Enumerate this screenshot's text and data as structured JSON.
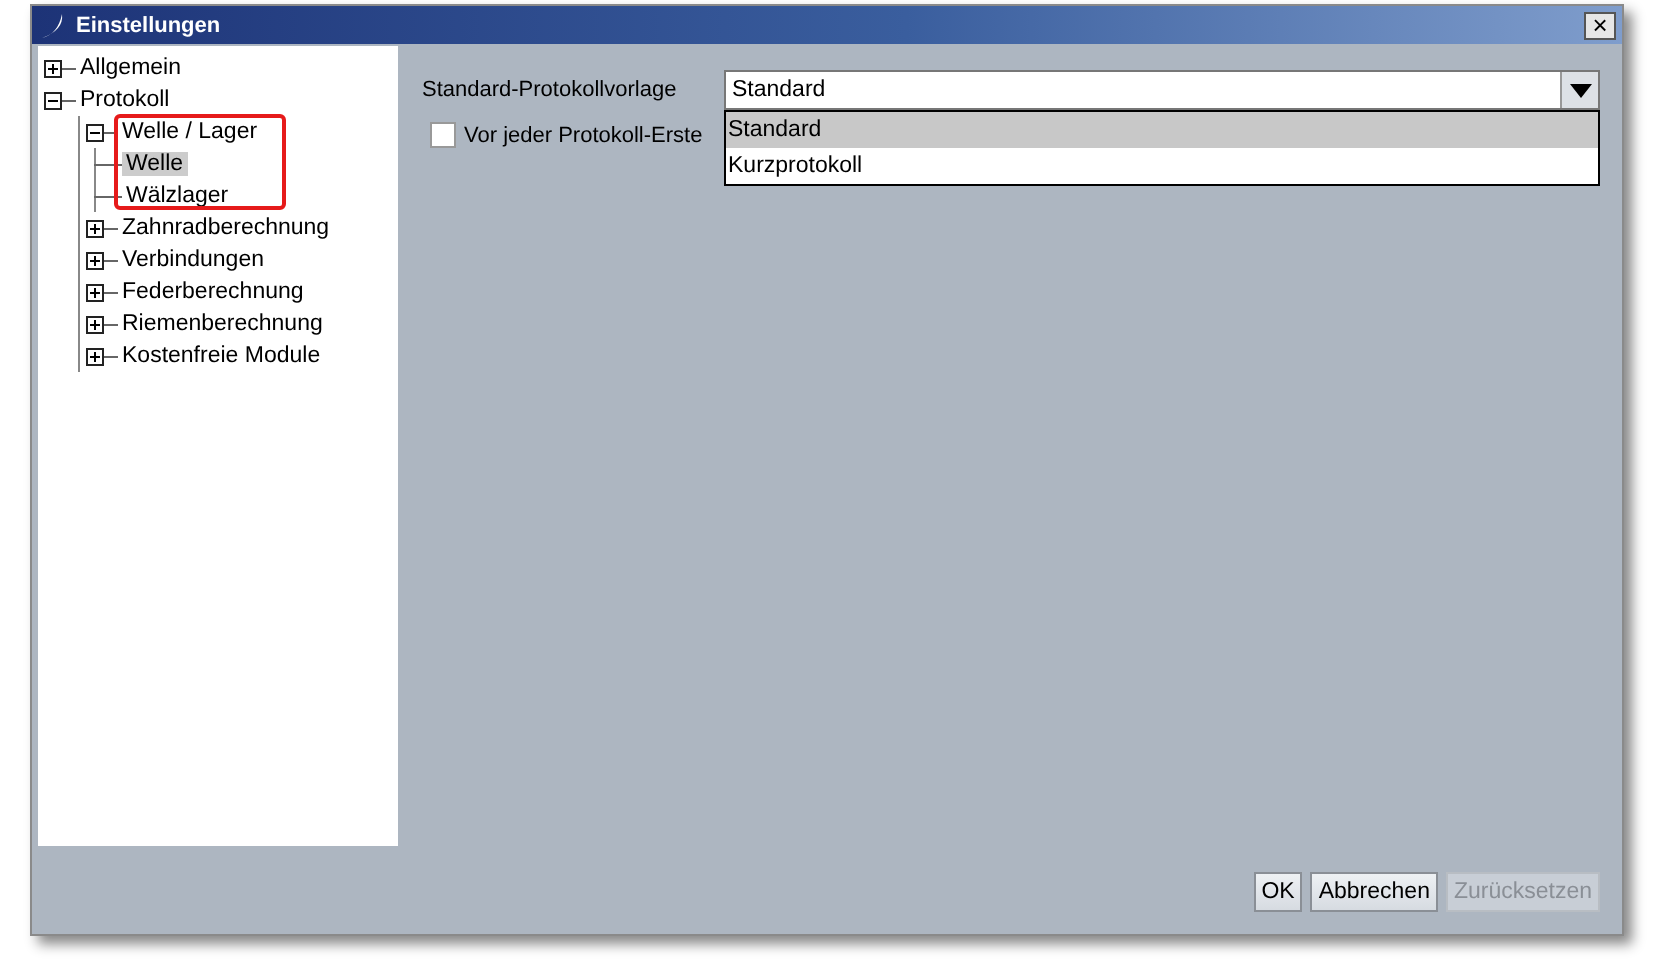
{
  "window": {
    "title": "Einstellungen",
    "close": "×"
  },
  "tree": [
    {
      "label": "Allgemein",
      "expanded": false,
      "selected": false
    },
    {
      "label": "Protokoll",
      "expanded": true,
      "selected": false,
      "children": [
        {
          "label": "Welle / Lager",
          "expanded": true,
          "selected": false,
          "children": [
            {
              "label": "Welle",
              "selected": true
            },
            {
              "label": "Wälzlager",
              "selected": false
            }
          ]
        },
        {
          "label": "Zahnradberechnung",
          "expanded": false,
          "selected": false
        },
        {
          "label": "Verbindungen",
          "expanded": false,
          "selected": false
        },
        {
          "label": "Federberechnung",
          "expanded": false,
          "selected": false
        },
        {
          "label": "Riemenberechnung",
          "expanded": false,
          "selected": false
        },
        {
          "label": "Kostenfreie Module",
          "expanded": false,
          "selected": false
        }
      ]
    }
  ],
  "settings": {
    "template_label": "Standard-Protokollvorlage",
    "template_value": "Standard",
    "dropdown_open": true,
    "options": [
      {
        "label": "Standard",
        "selected": true
      },
      {
        "label": "Kurzprotokoll",
        "selected": false
      }
    ],
    "checkbox": {
      "label": "Vor jeder Protokoll-Erste",
      "checked": false
    }
  },
  "buttons": [
    {
      "label": "OK",
      "disabled": false
    },
    {
      "label": "Abbrechen",
      "disabled": false
    },
    {
      "label": "Zurücksetzen",
      "disabled": true
    }
  ]
}
